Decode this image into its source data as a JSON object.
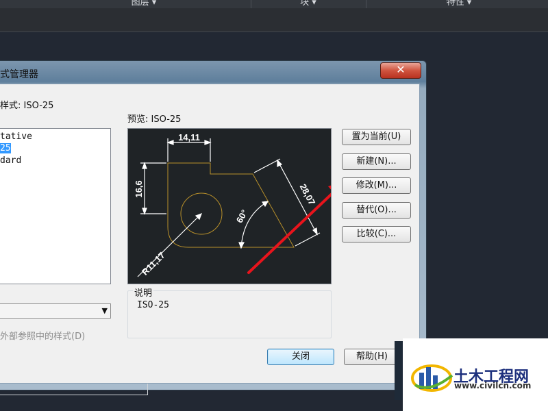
{
  "ribbon": {
    "panels": [
      {
        "label": "图层 ▾"
      },
      {
        "label": "块 ▾"
      },
      {
        "label": "特性 ▾"
      }
    ]
  },
  "dialog": {
    "title": "式管理器",
    "close_glyph": "✕",
    "current_style": "样式: ISO-25",
    "styles": [
      "tative",
      "25",
      "dard"
    ],
    "selected_index": 1,
    "filter_value": "",
    "xref_option": "外部参照中的样式(D)",
    "preview_label": "预览: ISO-25",
    "description_legend": "说明",
    "description_value": "ISO-25",
    "buttons": {
      "set_current": "置为当前(U)",
      "new": "新建(N)...",
      "modify": "修改(M)...",
      "override": "替代(O)...",
      "compare": "比较(C)...",
      "close": "关闭",
      "help": "帮助(H)"
    }
  },
  "preview_drawing": {
    "dim_top": "14,11",
    "dim_left": "16,6",
    "dim_diag": "28,07",
    "dim_angle": "60°",
    "dim_radius": "R11,17"
  },
  "watermark": {
    "name": "土木工程网",
    "url": "www.civilcn.com"
  },
  "colors": {
    "annotation_arrow": "#e8141c",
    "object_outline": "#b8902a"
  }
}
